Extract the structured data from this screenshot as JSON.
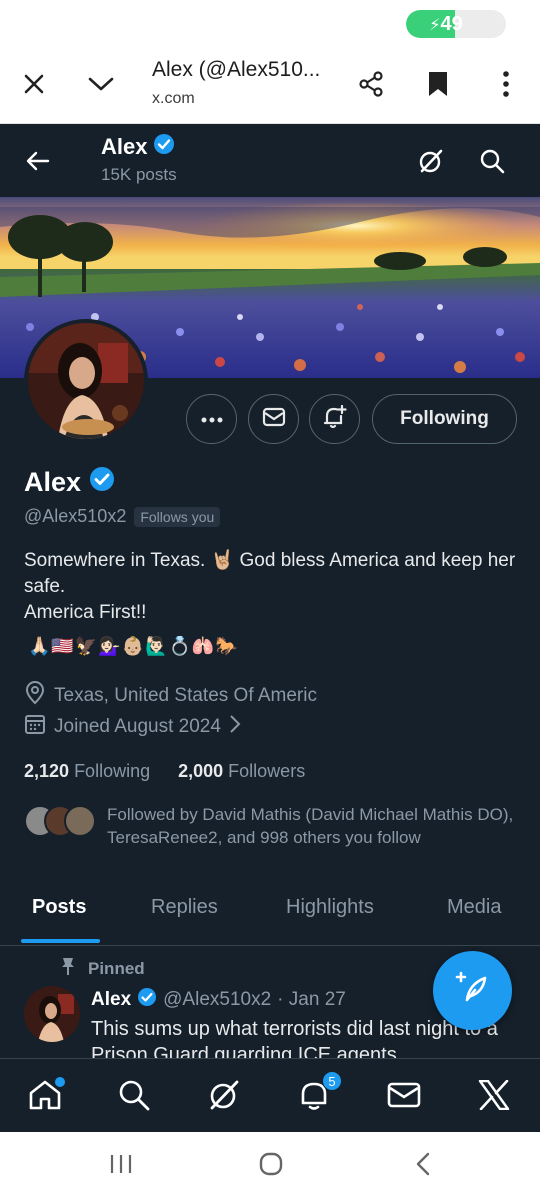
{
  "status_bar": {
    "battery_level": "49",
    "battery_charging": true
  },
  "browser": {
    "title": "Alex (@Alex510...",
    "url": "x.com"
  },
  "header": {
    "name": "Alex",
    "posts_count": "15K posts"
  },
  "profile": {
    "name": "Alex",
    "handle": "@Alex510x2",
    "follows_you": "Follows you",
    "bio": "Somewhere in Texas. 🤘🏼 God bless America and keep her safe.\nAmerica First!!",
    "emoji_line": "🙏🏻🇺🇸🦅💁🏻‍♀️👶🏼🙋🏻‍♂️💍🫁🐎",
    "location": "Texas, United States Of Americ",
    "joined": "Joined August 2024",
    "following_count": "2,120",
    "following_label": "Following",
    "followers_count": "2,000",
    "followers_label": "Followers",
    "followed_by": "Followed by David Mathis (David Michael Mathis DO), TeresaRenee2, and 998 others you follow",
    "following_button": "Following"
  },
  "tabs": [
    {
      "label": "Posts",
      "active": true
    },
    {
      "label": "Replies",
      "active": false
    },
    {
      "label": "Highlights",
      "active": false
    },
    {
      "label": "Media",
      "active": false
    }
  ],
  "pinned_post": {
    "pinned_label": "Pinned",
    "author": "Alex",
    "handle": "@Alex510x2",
    "date": "· Jan 27",
    "text": "This sums up what terrorists did last night to a Prison Guard guarding ICE agents."
  },
  "bottom_nav": {
    "notifications_badge": "5"
  },
  "colors": {
    "background": "#15202b",
    "accent": "#1d9bf0",
    "verified": "#1d9bf0"
  },
  "icons": [
    "close-icon",
    "chevron-down-icon",
    "share-icon",
    "bookmark-icon",
    "more-vertical-icon",
    "back-arrow-icon",
    "verified-icon",
    "grok-icon",
    "search-icon",
    "more-horizontal-icon",
    "mail-icon",
    "bell-plus-icon",
    "location-icon",
    "calendar-icon",
    "chevron-right-icon",
    "pin-icon",
    "compose-icon",
    "home-icon",
    "bell-icon",
    "x-logo-icon"
  ]
}
